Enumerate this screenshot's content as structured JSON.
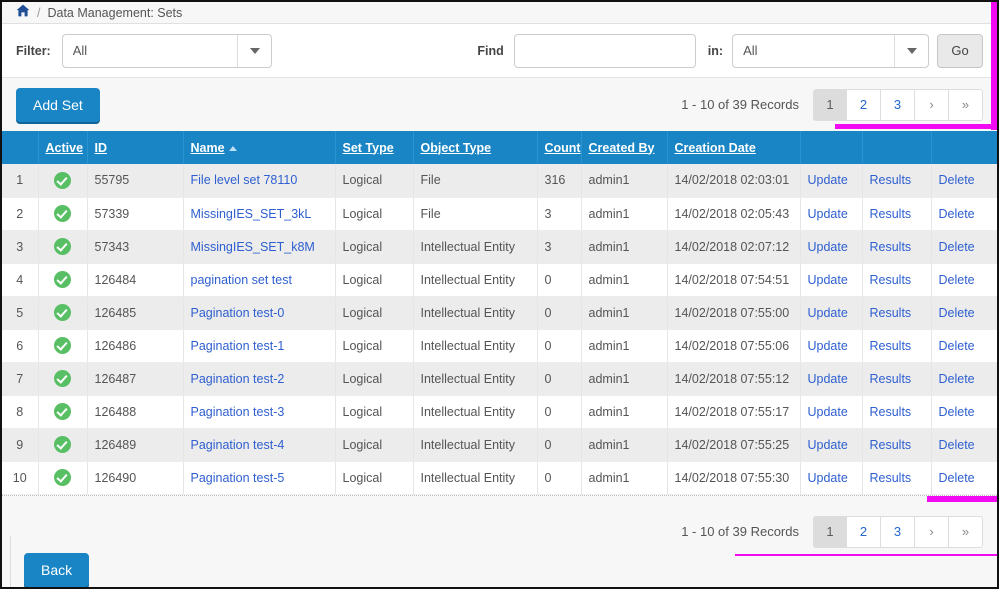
{
  "breadcrumb": {
    "home_icon": "home-icon",
    "separator": "/",
    "title": "Data Management: Sets"
  },
  "filter_bar": {
    "filter_label": "Filter:",
    "filter_value": "All",
    "find_label": "Find",
    "find_value": "",
    "find_placeholder": "",
    "in_label": "in:",
    "in_value": "All",
    "go_label": "Go"
  },
  "action_bar": {
    "add_set_label": "Add Set"
  },
  "pagination": {
    "records_text": "1 - 10 of 39 Records",
    "pages": [
      "1",
      "2",
      "3"
    ],
    "next_label": "›",
    "last_label": "»",
    "active_page": "1"
  },
  "table": {
    "columns": [
      {
        "label": "",
        "sortable": false
      },
      {
        "label": "Active",
        "sortable": true
      },
      {
        "label": "ID",
        "sortable": true
      },
      {
        "label": "Name",
        "sortable": true,
        "sort": "asc"
      },
      {
        "label": "Set Type",
        "sortable": true
      },
      {
        "label": "Object Type",
        "sortable": true
      },
      {
        "label": "Count",
        "sortable": true
      },
      {
        "label": "Created By",
        "sortable": true
      },
      {
        "label": "Creation Date",
        "sortable": true
      },
      {
        "label": "",
        "sortable": false
      },
      {
        "label": "",
        "sortable": false
      },
      {
        "label": "",
        "sortable": false
      }
    ],
    "action_labels": {
      "update": "Update",
      "results": "Results",
      "delete": "Delete"
    },
    "rows": [
      {
        "n": "1",
        "active": true,
        "id": "55795",
        "name": "File level set 78110",
        "set_type": "Logical",
        "object_type": "File",
        "count": "316",
        "created_by": "admin1",
        "created": "14/02/2018 02:03:01"
      },
      {
        "n": "2",
        "active": true,
        "id": "57339",
        "name": "MissingIES_SET_3kL",
        "set_type": "Logical",
        "object_type": "File",
        "count": "3",
        "created_by": "admin1",
        "created": "14/02/2018 02:05:43"
      },
      {
        "n": "3",
        "active": true,
        "id": "57343",
        "name": "MissingIES_SET_k8M",
        "set_type": "Logical",
        "object_type": "Intellectual Entity",
        "count": "3",
        "created_by": "admin1",
        "created": "14/02/2018 02:07:12"
      },
      {
        "n": "4",
        "active": true,
        "id": "126484",
        "name": "pagination set test",
        "set_type": "Logical",
        "object_type": "Intellectual Entity",
        "count": "0",
        "created_by": "admin1",
        "created": "14/02/2018 07:54:51"
      },
      {
        "n": "5",
        "active": true,
        "id": "126485",
        "name": "Pagination test-0",
        "set_type": "Logical",
        "object_type": "Intellectual Entity",
        "count": "0",
        "created_by": "admin1",
        "created": "14/02/2018 07:55:00"
      },
      {
        "n": "6",
        "active": true,
        "id": "126486",
        "name": "Pagination test-1",
        "set_type": "Logical",
        "object_type": "Intellectual Entity",
        "count": "0",
        "created_by": "admin1",
        "created": "14/02/2018 07:55:06"
      },
      {
        "n": "7",
        "active": true,
        "id": "126487",
        "name": "Pagination test-2",
        "set_type": "Logical",
        "object_type": "Intellectual Entity",
        "count": "0",
        "created_by": "admin1",
        "created": "14/02/2018 07:55:12"
      },
      {
        "n": "8",
        "active": true,
        "id": "126488",
        "name": "Pagination test-3",
        "set_type": "Logical",
        "object_type": "Intellectual Entity",
        "count": "0",
        "created_by": "admin1",
        "created": "14/02/2018 07:55:17"
      },
      {
        "n": "9",
        "active": true,
        "id": "126489",
        "name": "Pagination test-4",
        "set_type": "Logical",
        "object_type": "Intellectual Entity",
        "count": "0",
        "created_by": "admin1",
        "created": "14/02/2018 07:55:25"
      },
      {
        "n": "10",
        "active": true,
        "id": "126490",
        "name": "Pagination test-5",
        "set_type": "Logical",
        "object_type": "Intellectual Entity",
        "count": "0",
        "created_by": "admin1",
        "created": "14/02/2018 07:55:30"
      }
    ]
  },
  "footer": {
    "back_label": "Back"
  },
  "colors": {
    "header_blue": "#1a85c4",
    "link_blue": "#2e5fd0",
    "active_green": "#59bf64",
    "annotation_magenta": "#f20af2"
  }
}
